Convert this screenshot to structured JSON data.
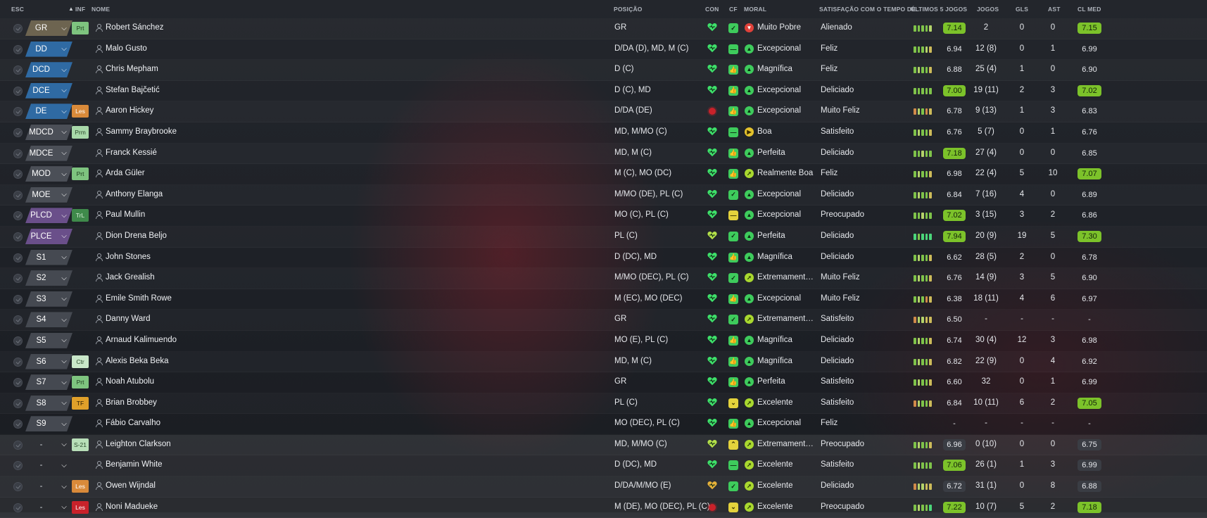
{
  "columns": {
    "esc": "ESC",
    "inf": "INF",
    "nome": "NOME",
    "posicao": "POSIÇÃO",
    "con": "CON",
    "cf": "CF",
    "moral": "MORAL",
    "satisfacao": "SATISFAÇÃO COM O TEMPO DE...",
    "ultimos": "ÚLTIMOS 5 JOGOS",
    "jogos": "JOGOS",
    "gls": "GLS",
    "ast": "AST",
    "clmed": "CL MED"
  },
  "colors": {
    "accent_green": "#7cc22a",
    "status_green": "#3ecb5c",
    "status_yellow": "#e4d23c",
    "injury_red": "#c8222a"
  },
  "players": [
    {
      "esc": "GR",
      "esc_group": "gk",
      "inf": "Prt",
      "inf_style": "prt",
      "name": "Robert Sánchez",
      "position": "GR",
      "con": "heart",
      "cf": "check",
      "cf_color": "green",
      "moral_icon": "down",
      "moral_color": "red",
      "moral": "Muito Pobre",
      "sat": "Alienado",
      "form": [
        "g",
        "g",
        "g",
        "g",
        "l"
      ],
      "form5": "7.14",
      "form5_style": "green",
      "jogos": "2",
      "gls": "0",
      "ast": "0",
      "clmed": "7.15",
      "clmed_style": "green"
    },
    {
      "esc": "DD",
      "esc_group": "def",
      "inf": "",
      "inf_style": "",
      "name": "Malo Gusto",
      "position": "D/DA (D), MD, M (C)",
      "con": "heart",
      "cf": "dash",
      "cf_color": "green",
      "moral_icon": "up",
      "moral_color": "green",
      "moral": "Excepcional",
      "sat": "Feliz",
      "form": [
        "g",
        "g",
        "g",
        "l",
        "y"
      ],
      "form5": "6.94",
      "form5_style": "none",
      "jogos": "12 (8)",
      "gls": "0",
      "ast": "1",
      "clmed": "6.99",
      "clmed_style": "none"
    },
    {
      "esc": "DCD",
      "esc_group": "def",
      "inf": "",
      "inf_style": "",
      "name": "Chris Mepham",
      "position": "D (C)",
      "con": "heart",
      "cf": "thumb",
      "cf_color": "green",
      "moral_icon": "up",
      "moral_color": "green",
      "moral": "Magnífica",
      "sat": "Feliz",
      "form": [
        "g",
        "l",
        "g",
        "g",
        "y"
      ],
      "form5": "6.88",
      "form5_style": "none",
      "jogos": "25 (4)",
      "gls": "1",
      "ast": "0",
      "clmed": "6.90",
      "clmed_style": "none"
    },
    {
      "esc": "DCE",
      "esc_group": "def",
      "inf": "",
      "inf_style": "",
      "name": "Stefan Bajčetić",
      "position": "D (C), MD",
      "con": "heart",
      "cf": "thumb",
      "cf_color": "green",
      "moral_icon": "up",
      "moral_color": "green",
      "moral": "Excepcional",
      "sat": "Deliciado",
      "form": [
        "g",
        "g",
        "g",
        "g",
        "g"
      ],
      "form5": "7.00",
      "form5_style": "green",
      "jogos": "19 (11)",
      "gls": "2",
      "ast": "3",
      "clmed": "7.02",
      "clmed_style": "green"
    },
    {
      "esc": "DE",
      "esc_group": "def",
      "inf": "Les",
      "inf_style": "les",
      "name": "Aaron Hickey",
      "position": "D/DA (DE)",
      "con": "injury",
      "cf": "thumb",
      "cf_color": "green",
      "moral_icon": "up",
      "moral_color": "green",
      "moral": "Excepcional",
      "sat": "Muito Feliz",
      "form": [
        "o",
        "l",
        "g",
        "o",
        "y"
      ],
      "form5": "6.78",
      "form5_style": "none",
      "jogos": "9 (13)",
      "gls": "1",
      "ast": "3",
      "clmed": "6.83",
      "clmed_style": "none"
    },
    {
      "esc": "MDCD",
      "esc_group": "mid",
      "inf": "Prm",
      "inf_style": "prm",
      "name": "Sammy Braybrooke",
      "position": "MD, M/MO (C)",
      "con": "heart",
      "cf": "dash",
      "cf_color": "green",
      "moral_icon": "right",
      "moral_color": "yellow",
      "moral": "Boa",
      "sat": "Satisfeito",
      "form": [
        "g",
        "l",
        "g",
        "g",
        "y"
      ],
      "form5": "6.76",
      "form5_style": "none",
      "jogos": "5 (7)",
      "gls": "0",
      "ast": "1",
      "clmed": "6.76",
      "clmed_style": "none"
    },
    {
      "esc": "MDCE",
      "esc_group": "mid",
      "inf": "",
      "inf_style": "",
      "name": "Franck Kessié",
      "position": "MD, M (C)",
      "con": "heart",
      "cf": "thumb",
      "cf_color": "green",
      "moral_icon": "up",
      "moral_color": "green",
      "moral": "Perfeita",
      "sat": "Deliciado",
      "form": [
        "g",
        "g",
        "l",
        "g",
        "g"
      ],
      "form5": "7.18",
      "form5_style": "green",
      "jogos": "27 (4)",
      "gls": "0",
      "ast": "0",
      "clmed": "6.85",
      "clmed_style": "none"
    },
    {
      "esc": "MOD",
      "esc_group": "mid",
      "inf": "Prt",
      "inf_style": "prt",
      "name": "Arda Güler",
      "position": "M (C), MO (DC)",
      "con": "heart",
      "cf": "thumb",
      "cf_color": "green",
      "moral_icon": "upright",
      "moral_color": "lime",
      "moral": "Realmente Boa",
      "sat": "Feliz",
      "form": [
        "g",
        "l",
        "g",
        "g",
        "y"
      ],
      "form5": "6.98",
      "form5_style": "none",
      "jogos": "22 (4)",
      "gls": "5",
      "ast": "10",
      "clmed": "7.07",
      "clmed_style": "green"
    },
    {
      "esc": "MOE",
      "esc_group": "mid",
      "inf": "",
      "inf_style": "",
      "name": "Anthony Elanga",
      "position": "M/MO (DE), PL (C)",
      "con": "heart",
      "cf": "check",
      "cf_color": "green",
      "moral_icon": "up",
      "moral_color": "green",
      "moral": "Excepcional",
      "sat": "Deliciado",
      "form": [
        "g",
        "l",
        "g",
        "g",
        "y"
      ],
      "form5": "6.84",
      "form5_style": "none",
      "jogos": "7 (16)",
      "gls": "4",
      "ast": "0",
      "clmed": "6.89",
      "clmed_style": "none"
    },
    {
      "esc": "PLCD",
      "esc_group": "att",
      "inf": "TrL",
      "inf_style": "trl",
      "name": "Paul Mullin",
      "position": "MO (C), PL (C)",
      "con": "heart",
      "cf": "dash",
      "cf_color": "yellow",
      "moral_icon": "up",
      "moral_color": "green",
      "moral": "Excepcional",
      "sat": "Preocupado",
      "form": [
        "g",
        "g",
        "l",
        "g",
        "g"
      ],
      "form5": "7.02",
      "form5_style": "green",
      "jogos": "3 (15)",
      "gls": "3",
      "ast": "2",
      "clmed": "6.86",
      "clmed_style": "none"
    },
    {
      "esc": "PLCE",
      "esc_group": "att",
      "inf": "",
      "inf_style": "",
      "name": "Dion Drena Beljo",
      "position": "PL (C)",
      "con": "heart-lime",
      "cf": "check",
      "cf_color": "green",
      "moral_icon": "up",
      "moral_color": "green",
      "moral": "Perfeita",
      "sat": "Deliciado",
      "form": [
        "gb",
        "g",
        "gb",
        "gb",
        "gb"
      ],
      "form5": "7.94",
      "form5_style": "green",
      "jogos": "20 (9)",
      "gls": "19",
      "ast": "5",
      "clmed": "7.30",
      "clmed_style": "green"
    },
    {
      "esc": "S1",
      "esc_group": "sub",
      "inf": "",
      "inf_style": "",
      "name": "John Stones",
      "position": "D (DC), MD",
      "con": "heart",
      "cf": "thumb",
      "cf_color": "green",
      "moral_icon": "up",
      "moral_color": "green",
      "moral": "Magnífica",
      "sat": "Deliciado",
      "form": [
        "g",
        "l",
        "g",
        "g",
        "y"
      ],
      "form5": "6.62",
      "form5_style": "none",
      "jogos": "28 (5)",
      "gls": "2",
      "ast": "0",
      "clmed": "6.78",
      "clmed_style": "none"
    },
    {
      "esc": "S2",
      "esc_group": "sub",
      "inf": "",
      "inf_style": "",
      "name": "Jack Grealish",
      "position": "M/MO (DEC), PL (C)",
      "con": "heart",
      "cf": "check",
      "cf_color": "green",
      "moral_icon": "upright",
      "moral_color": "lime",
      "moral": "Extremamente...",
      "sat": "Muito Feliz",
      "form": [
        "g",
        "l",
        "g",
        "g",
        "y"
      ],
      "form5": "6.76",
      "form5_style": "none",
      "jogos": "14 (9)",
      "gls": "3",
      "ast": "5",
      "clmed": "6.90",
      "clmed_style": "none"
    },
    {
      "esc": "S3",
      "esc_group": "sub",
      "inf": "",
      "inf_style": "",
      "name": "Emile Smith Rowe",
      "position": "M (EC), MO (DEC)",
      "con": "heart",
      "cf": "thumb",
      "cf_color": "green",
      "moral_icon": "up",
      "moral_color": "green",
      "moral": "Excepcional",
      "sat": "Muito Feliz",
      "form": [
        "g",
        "l",
        "g",
        "o",
        "y"
      ],
      "form5": "6.38",
      "form5_style": "none",
      "jogos": "18 (11)",
      "gls": "4",
      "ast": "6",
      "clmed": "6.97",
      "clmed_style": "none"
    },
    {
      "esc": "S4",
      "esc_group": "sub",
      "inf": "",
      "inf_style": "",
      "name": "Danny Ward",
      "position": "GR",
      "con": "heart",
      "cf": "check",
      "cf_color": "green",
      "moral_icon": "upright",
      "moral_color": "lime",
      "moral": "Extremamente...",
      "sat": "Satisfeito",
      "form": [
        "o",
        "l",
        "l",
        "y",
        "y"
      ],
      "form5": "6.50",
      "form5_style": "none",
      "jogos": "-",
      "gls": "-",
      "ast": "-",
      "clmed": "-",
      "clmed_style": "none"
    },
    {
      "esc": "S5",
      "esc_group": "sub",
      "inf": "",
      "inf_style": "",
      "name": "Arnaud Kalimuendo",
      "position": "MO (E), PL (C)",
      "con": "heart",
      "cf": "thumb",
      "cf_color": "green",
      "moral_icon": "up",
      "moral_color": "green",
      "moral": "Magnífica",
      "sat": "Deliciado",
      "form": [
        "g",
        "l",
        "g",
        "g",
        "y"
      ],
      "form5": "6.74",
      "form5_style": "none",
      "jogos": "30 (4)",
      "gls": "12",
      "ast": "3",
      "clmed": "6.98",
      "clmed_style": "none"
    },
    {
      "esc": "S6",
      "esc_group": "sub",
      "inf": "Ctr",
      "inf_style": "ctr",
      "name": "Alexis Beka Beka",
      "position": "MD, M (C)",
      "con": "heart",
      "cf": "thumb",
      "cf_color": "green",
      "moral_icon": "up",
      "moral_color": "green",
      "moral": "Magnífica",
      "sat": "Deliciado",
      "form": [
        "g",
        "l",
        "g",
        "g",
        "y"
      ],
      "form5": "6.82",
      "form5_style": "none",
      "jogos": "22 (9)",
      "gls": "0",
      "ast": "4",
      "clmed": "6.92",
      "clmed_style": "none"
    },
    {
      "esc": "S7",
      "esc_group": "sub",
      "inf": "Prt",
      "inf_style": "prt",
      "name": "Noah Atubolu",
      "position": "GR",
      "con": "heart",
      "cf": "thumb",
      "cf_color": "green",
      "moral_icon": "up",
      "moral_color": "green",
      "moral": "Perfeita",
      "sat": "Satisfeito",
      "form": [
        "g",
        "l",
        "g",
        "g",
        "y"
      ],
      "form5": "6.60",
      "form5_style": "none",
      "jogos": "32",
      "gls": "0",
      "ast": "1",
      "clmed": "6.99",
      "clmed_style": "none"
    },
    {
      "esc": "S8",
      "esc_group": "sub",
      "inf": "TF",
      "inf_style": "tf",
      "name": "Brian Brobbey",
      "position": "PL (C)",
      "con": "heart",
      "cf": "down",
      "cf_color": "yellow",
      "moral_icon": "upright",
      "moral_color": "lime",
      "moral": "Excelente",
      "sat": "Satisfeito",
      "form": [
        "o",
        "l",
        "g",
        "g",
        "y"
      ],
      "form5": "6.84",
      "form5_style": "none",
      "jogos": "10 (11)",
      "gls": "6",
      "ast": "2",
      "clmed": "7.05",
      "clmed_style": "green"
    },
    {
      "esc": "S9",
      "esc_group": "sub",
      "inf": "",
      "inf_style": "",
      "name": "Fábio Carvalho",
      "position": "MO (DEC), PL (C)",
      "con": "heart",
      "cf": "thumb",
      "cf_color": "green",
      "moral_icon": "up",
      "moral_color": "green",
      "moral": "Excepcional",
      "sat": "Feliz",
      "form": [],
      "form5": "-",
      "form5_style": "none",
      "jogos": "-",
      "gls": "-",
      "ast": "-",
      "clmed": "-",
      "clmed_style": "none"
    },
    {
      "esc": "-",
      "esc_group": "res",
      "inf": "S-21",
      "inf_style": "s21",
      "name": "Leighton Clarkson",
      "position": "MD, M/MO (C)",
      "con": "heart-lime",
      "cf": "up",
      "cf_color": "yellow",
      "moral_icon": "upright",
      "moral_color": "lime",
      "moral": "Extremamente...",
      "sat": "Preocupado",
      "form": [
        "g",
        "l",
        "g",
        "g",
        "y"
      ],
      "form5": "6.96",
      "form5_style": "dark",
      "jogos": "0 (10)",
      "gls": "0",
      "ast": "0",
      "clmed": "6.75",
      "clmed_style": "dark"
    },
    {
      "esc": "-",
      "esc_group": "res",
      "inf": "",
      "inf_style": "",
      "name": "Benjamin White",
      "position": "D (DC), MD",
      "con": "heart",
      "cf": "dash",
      "cf_color": "green",
      "moral_icon": "upright",
      "moral_color": "lime",
      "moral": "Excelente",
      "sat": "Satisfeito",
      "form": [
        "g",
        "l",
        "g",
        "g",
        "g"
      ],
      "form5": "7.06",
      "form5_style": "green",
      "jogos": "26 (1)",
      "gls": "1",
      "ast": "3",
      "clmed": "6.99",
      "clmed_style": "dark"
    },
    {
      "esc": "-",
      "esc_group": "res",
      "inf": "Les",
      "inf_style": "les",
      "name": "Owen Wijndal",
      "position": "D/DA/M/MO (E)",
      "con": "heart-orange",
      "cf": "check",
      "cf_color": "green",
      "moral_icon": "upright",
      "moral_color": "lime",
      "moral": "Excelente",
      "sat": "Deliciado",
      "form": [
        "o",
        "l",
        "l",
        "y",
        "y"
      ],
      "form5": "6.72",
      "form5_style": "dark",
      "jogos": "31 (1)",
      "gls": "0",
      "ast": "8",
      "clmed": "6.88",
      "clmed_style": "dark"
    },
    {
      "esc": "-",
      "esc_group": "res",
      "inf": "Les",
      "inf_style": "lesred",
      "name": "Noni Madueke",
      "position": "M (DE), MO (DEC), PL (C)",
      "con": "injury",
      "cf": "down",
      "cf_color": "yellow",
      "moral_icon": "upright",
      "moral_color": "lime",
      "moral": "Excelente",
      "sat": "Preocupado",
      "form": [
        "g",
        "l",
        "g",
        "g",
        "gb"
      ],
      "form5": "7.22",
      "form5_style": "green",
      "jogos": "10 (7)",
      "gls": "5",
      "ast": "2",
      "clmed": "7.18",
      "clmed_style": "green"
    }
  ]
}
